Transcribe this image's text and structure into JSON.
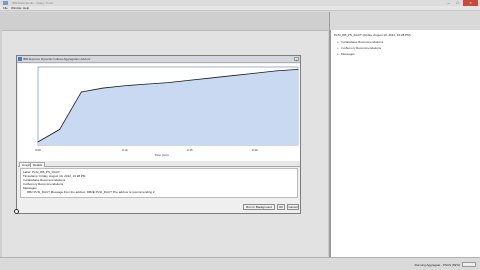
{
  "window": {
    "title": "IBM Data Studio - Query Tuner",
    "minimize": "–",
    "maximize": "□",
    "close": "×"
  },
  "menu": [
    "File",
    "Window",
    "Help"
  ],
  "right_panel": {
    "title": "PLSI_DB_PS_DACT (Friday, August 10, 2012, 10:28 PM)",
    "items": [
      {
        "toggle": "+",
        "label": "In-Database Recommendations"
      },
      {
        "toggle": "+",
        "label": "In-Memory Recommendations"
      },
      {
        "toggle": "+",
        "label": "Messages"
      }
    ]
  },
  "dialog": {
    "title": "IBM Express Dynamic Indices Aggregation Advisor",
    "close": "×",
    "tabs": [
      "Graph",
      "Details"
    ],
    "details": [
      "Label: PLSI_DB_PS_DACT",
      "Timestamp: Friday, August 10, 2012, 10:28 PM",
      "In-Database Recommendations",
      "In-Memory Recommendations",
      "Messages",
      "DB2 PLSI_DACT Message from the advisor: DB2E PLSI_DACT The advisor is recommending 2"
    ],
    "buttons": {
      "run": "Run In Background",
      "ok": "OK",
      "cancel": "Cancel"
    }
  },
  "chart_data": {
    "type": "area",
    "x": [
      0,
      0.5,
      1,
      1.5,
      2,
      2.5,
      3,
      3.5,
      4,
      4.5,
      5,
      5.5,
      6
    ],
    "values": [
      0.04,
      0.2,
      0.68,
      0.73,
      0.76,
      0.78,
      0.8,
      0.83,
      0.86,
      0.89,
      0.92,
      0.95,
      0.97
    ],
    "xticks": [
      "0:00",
      "0:10",
      "0:15",
      "0:30"
    ],
    "xlabel": "Time (min)",
    "xlim": [
      0,
      6
    ],
    "ylim": [
      0,
      1
    ],
    "colors": {
      "fill": "#c9d9f2",
      "line": "#1a1a1a",
      "grid": "#5f7fb5"
    }
  },
  "status": {
    "text": "Running Aggregate - PSCS (69%)"
  }
}
